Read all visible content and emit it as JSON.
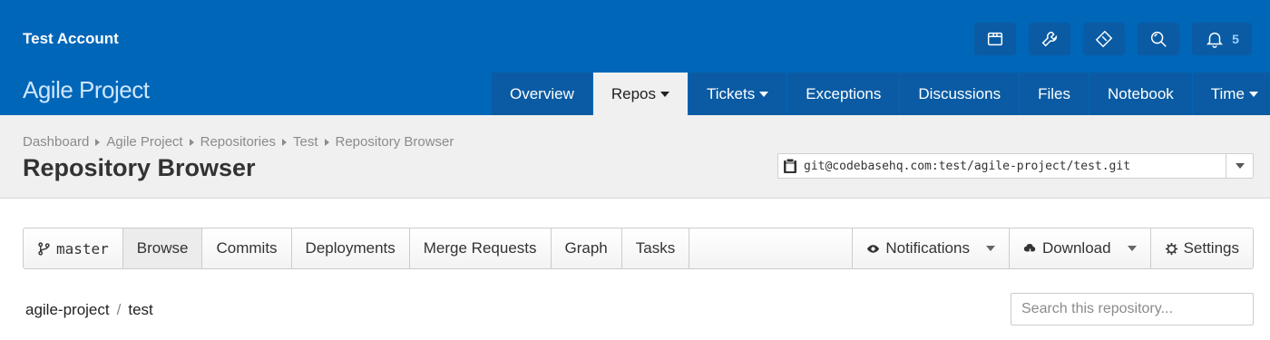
{
  "header": {
    "account": "Test Account",
    "project": "Agile Project",
    "notifications_count": "5",
    "icons": [
      "box-icon",
      "wrench-icon",
      "ticket-icon",
      "search-icon",
      "bell-icon"
    ],
    "nav": [
      {
        "label": "Overview",
        "dropdown": false,
        "active": false
      },
      {
        "label": "Repos",
        "dropdown": true,
        "active": true
      },
      {
        "label": "Tickets",
        "dropdown": true,
        "active": false
      },
      {
        "label": "Exceptions",
        "dropdown": false,
        "active": false
      },
      {
        "label": "Discussions",
        "dropdown": false,
        "active": false
      },
      {
        "label": "Files",
        "dropdown": false,
        "active": false
      },
      {
        "label": "Notebook",
        "dropdown": false,
        "active": false
      },
      {
        "label": "Time",
        "dropdown": true,
        "active": false
      }
    ]
  },
  "breadcrumb": [
    "Dashboard",
    "Agile Project",
    "Repositories",
    "Test",
    "Repository Browser"
  ],
  "page_title": "Repository Browser",
  "clone_url": "git@codebasehq.com:test/agile-project/test.git",
  "toolbar": {
    "branch": "master",
    "browse": "Browse",
    "commits": "Commits",
    "deployments": "Deployments",
    "merge_requests": "Merge Requests",
    "graph": "Graph",
    "tasks": "Tasks",
    "notifications": "Notifications",
    "download": "Download",
    "settings": "Settings"
  },
  "path": {
    "repo": "agile-project",
    "sep": "/",
    "name": "test"
  },
  "search": {
    "placeholder": "Search this repository..."
  },
  "colors": {
    "header_bg": "#0066b8",
    "nav_bg": "#0a5ba3",
    "subheader_bg": "#f0f0f0"
  }
}
